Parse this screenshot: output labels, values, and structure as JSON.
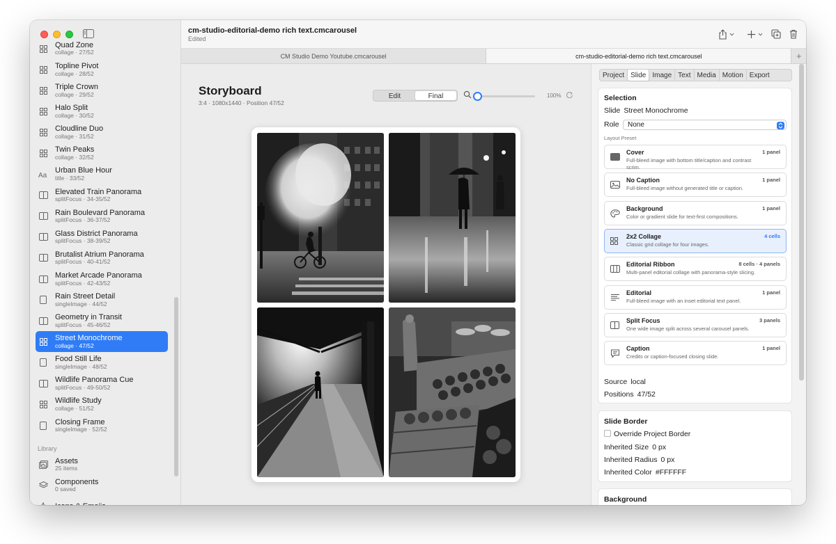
{
  "header": {
    "title": "cm-studio-editorial-demo rich text.cmcarousel",
    "subtitle": "Edited"
  },
  "tabs": [
    {
      "label": "CM Studio Demo Youtube.cmcarousel"
    },
    {
      "label": "cm-studio-editorial-demo rich text.cmcarousel"
    }
  ],
  "sidebar": {
    "items": [
      {
        "title": "Quad Zone",
        "sub": "collage · 27/52",
        "icon": "grid-icon"
      },
      {
        "title": "Topline Pivot",
        "sub": "collage · 28/52",
        "icon": "grid-icon"
      },
      {
        "title": "Triple Crown",
        "sub": "collage · 29/52",
        "icon": "grid-icon"
      },
      {
        "title": "Halo Split",
        "sub": "collage · 30/52",
        "icon": "grid-icon"
      },
      {
        "title": "Cloudline Duo",
        "sub": "collage · 31/52",
        "icon": "grid-icon"
      },
      {
        "title": "Twin Peaks",
        "sub": "collage · 32/52",
        "icon": "grid-icon"
      },
      {
        "title": "Urban Blue Hour",
        "sub": "title · 33/52",
        "icon": "text-icon"
      },
      {
        "title": "Elevated Train Panorama",
        "sub": "splitFocus · 34-35/52",
        "icon": "split-icon"
      },
      {
        "title": "Rain Boulevard Panorama",
        "sub": "splitFocus · 36-37/52",
        "icon": "split-icon"
      },
      {
        "title": "Glass District Panorama",
        "sub": "splitFocus · 38-39/52",
        "icon": "split-icon"
      },
      {
        "title": "Brutalist Atrium Panorama",
        "sub": "splitFocus · 40-41/52",
        "icon": "split-icon"
      },
      {
        "title": "Market Arcade Panorama",
        "sub": "splitFocus · 42-43/52",
        "icon": "split-icon"
      },
      {
        "title": "Rain Street Detail",
        "sub": "singleImage · 44/52",
        "icon": "single-icon"
      },
      {
        "title": "Geometry in Transit",
        "sub": "splitFocus · 45-46/52",
        "icon": "split-icon"
      },
      {
        "title": "Street Monochrome",
        "sub": "collage · 47/52",
        "icon": "grid-icon",
        "selected": true
      },
      {
        "title": "Food Still Life",
        "sub": "singleImage · 48/52",
        "icon": "single-icon"
      },
      {
        "title": "Wildlife Panorama Cue",
        "sub": "splitFocus · 49-50/52",
        "icon": "split-icon"
      },
      {
        "title": "Wildlife Study",
        "sub": "collage · 51/52",
        "icon": "grid-icon"
      },
      {
        "title": "Closing Frame",
        "sub": "singleImage · 52/52",
        "icon": "single-icon"
      }
    ],
    "library_label": "Library",
    "library": [
      {
        "title": "Assets",
        "sub": "25 items",
        "icon": "photos-icon"
      },
      {
        "title": "Components",
        "sub": "0 saved",
        "icon": "layers-icon"
      },
      {
        "title": "Icons & Emojis",
        "sub": "",
        "icon": "star-icon"
      }
    ]
  },
  "canvas": {
    "title": "Storyboard",
    "meta": "3:4 · 1080x1440 · Position 47/52",
    "mode_edit": "Edit",
    "mode_final": "Final",
    "zoom_label": "100%",
    "zoom_fraction": 0.0
  },
  "inspector": {
    "tabs": [
      "Project",
      "Slide",
      "Image",
      "Text",
      "Media",
      "Motion",
      "Export"
    ],
    "active_tab": "Slide",
    "selection": {
      "heading": "Selection",
      "slide_label": "Slide",
      "slide_value": "Street Monochrome",
      "role_label": "Role",
      "role_value": "None",
      "layout_label": "Layout Preset",
      "source_label": "Source",
      "source_value": "local",
      "positions_label": "Positions",
      "positions_value": "47/52"
    },
    "presets": [
      {
        "name": "Cover",
        "desc": "Full-bleed image with bottom title/caption and contrast scrim.",
        "count": "1 panel",
        "icon": "cover-icon"
      },
      {
        "name": "No Caption",
        "desc": "Full-bleed image without generated title or caption.",
        "count": "1 panel",
        "icon": "image-icon"
      },
      {
        "name": "Background",
        "desc": "Color or gradient slide for text-first compositions.",
        "count": "1 panel",
        "icon": "palette-icon"
      },
      {
        "name": "2x2 Collage",
        "desc": "Classic grid collage for four images.",
        "count": "4 cells",
        "icon": "grid-icon",
        "selected": true
      },
      {
        "name": "Editorial Ribbon",
        "desc": "Multi-panel editorial collage with panorama-style slicing.",
        "count": "8 cells · 4 panels",
        "icon": "ribbon-icon"
      },
      {
        "name": "Editorial",
        "desc": "Full-bleed image with an inset editorial text panel.",
        "count": "1 panel",
        "icon": "lines-icon"
      },
      {
        "name": "Split Focus",
        "desc": "One wide image split across several carousel panels.",
        "count": "3 panels",
        "icon": "split-icon"
      },
      {
        "name": "Caption",
        "desc": "Credits or caption-focused closing slide.",
        "count": "1 panel",
        "icon": "bubble-icon"
      }
    ],
    "border": {
      "heading": "Slide Border",
      "override_label": "Override Project Border",
      "size_label": "Inherited Size",
      "size_value": "0 px",
      "radius_label": "Inherited Radius",
      "radius_value": "0 px",
      "color_label": "Inherited Color",
      "color_value": "#FFFFFF"
    },
    "background_heading": "Background"
  },
  "colors": {
    "accent": "#2f7cf6",
    "selection_bg": "#e8f0fd"
  }
}
